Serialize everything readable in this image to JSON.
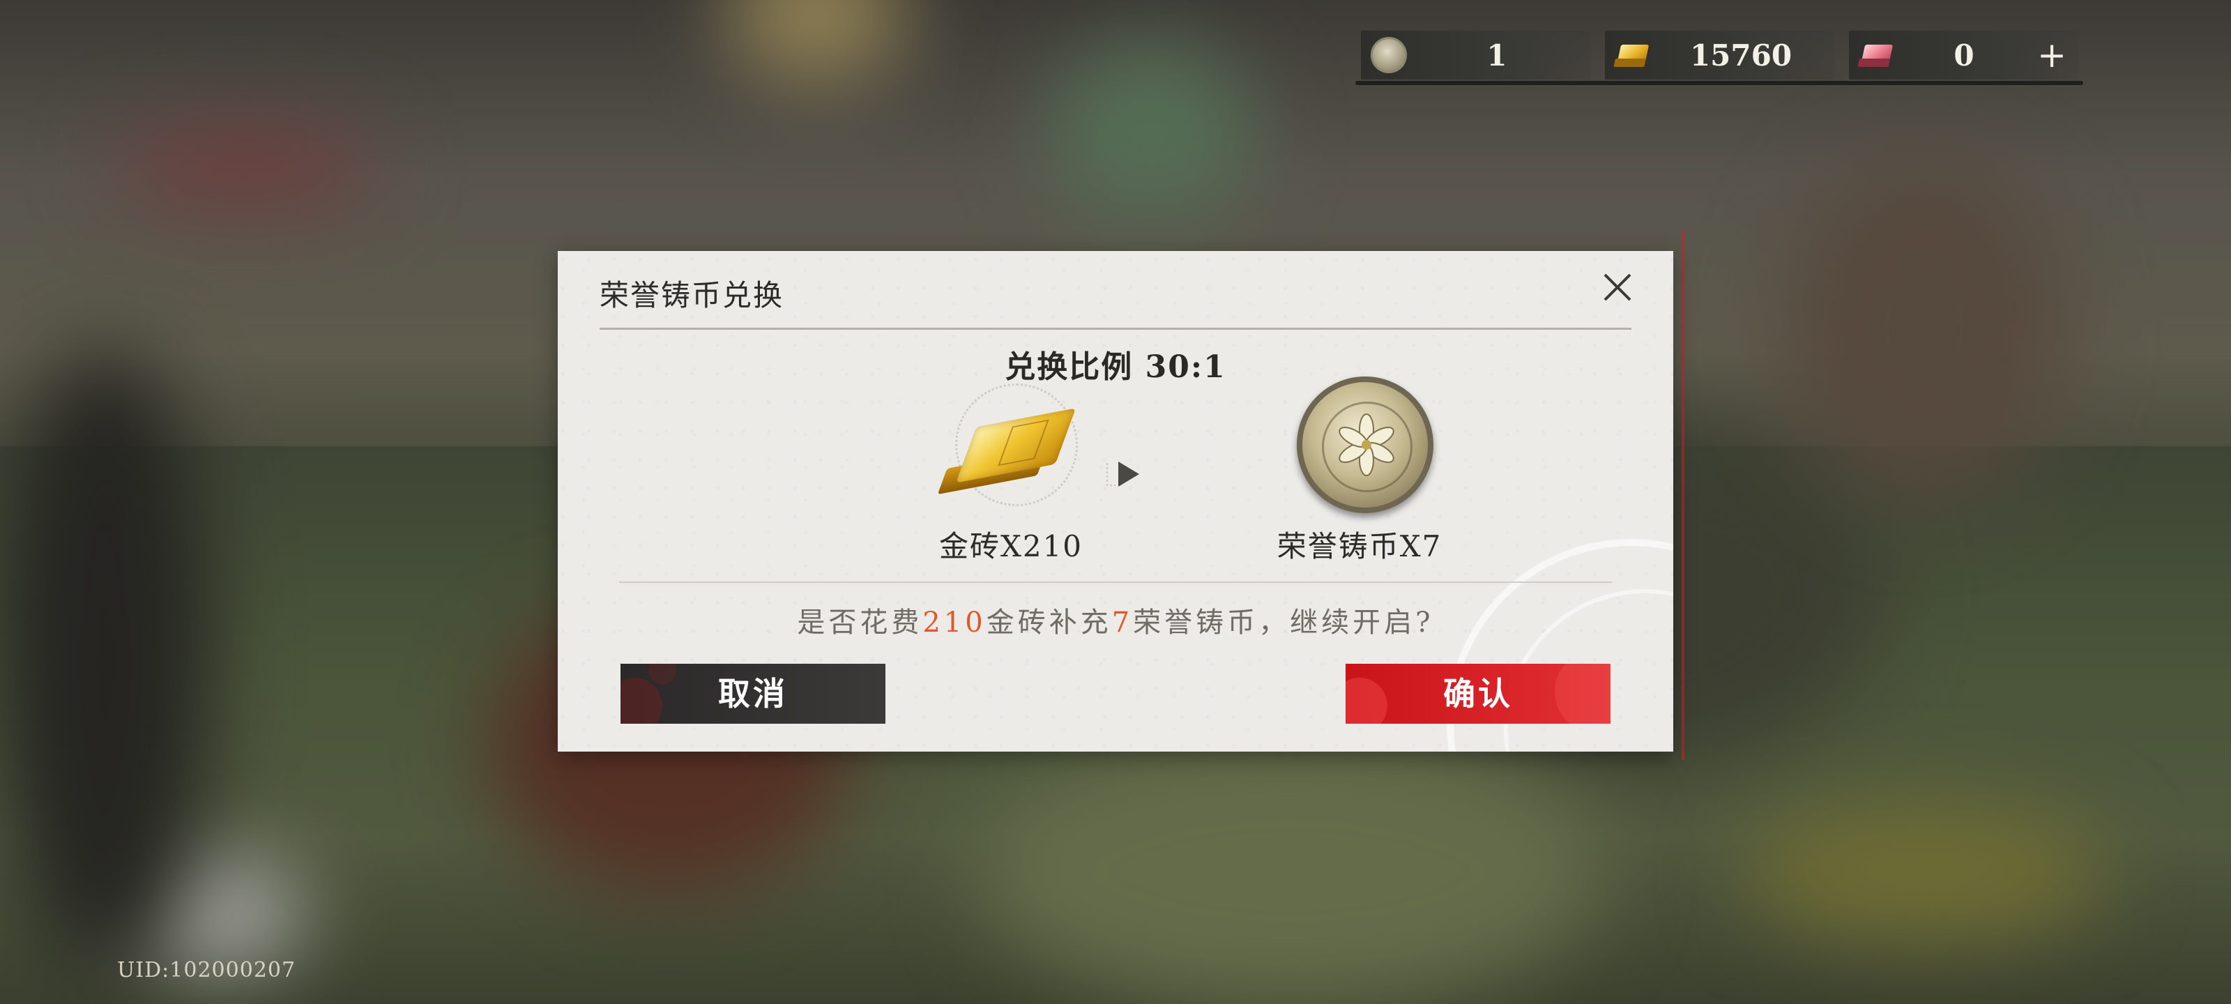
{
  "currency_bar": {
    "items": [
      {
        "icon": "honor-coin-icon",
        "value": "1"
      },
      {
        "icon": "gold-brick-icon",
        "value": "15760"
      },
      {
        "icon": "pink-brick-icon",
        "value": "0",
        "action": "+"
      }
    ]
  },
  "dialog": {
    "title": "荣誉铸币兑换",
    "ratio": "兑换比例 30:1",
    "from_item": {
      "icon": "gold-brick-icon",
      "label": "金砖X210"
    },
    "to_item": {
      "icon": "honor-coin-icon",
      "label": "荣誉铸币X7"
    },
    "prompt": {
      "prefix": "是否花费",
      "cost": "210",
      "middle": "金砖补充",
      "amount": "7",
      "suffix": "荣誉铸币，继续开启?"
    },
    "cancel_label": "取消",
    "confirm_label": "确认"
  },
  "uid": "UID:102000207",
  "colors": {
    "highlight": "#e0572a",
    "confirm": "#d81f24",
    "cancel": "#2f2e2d"
  }
}
